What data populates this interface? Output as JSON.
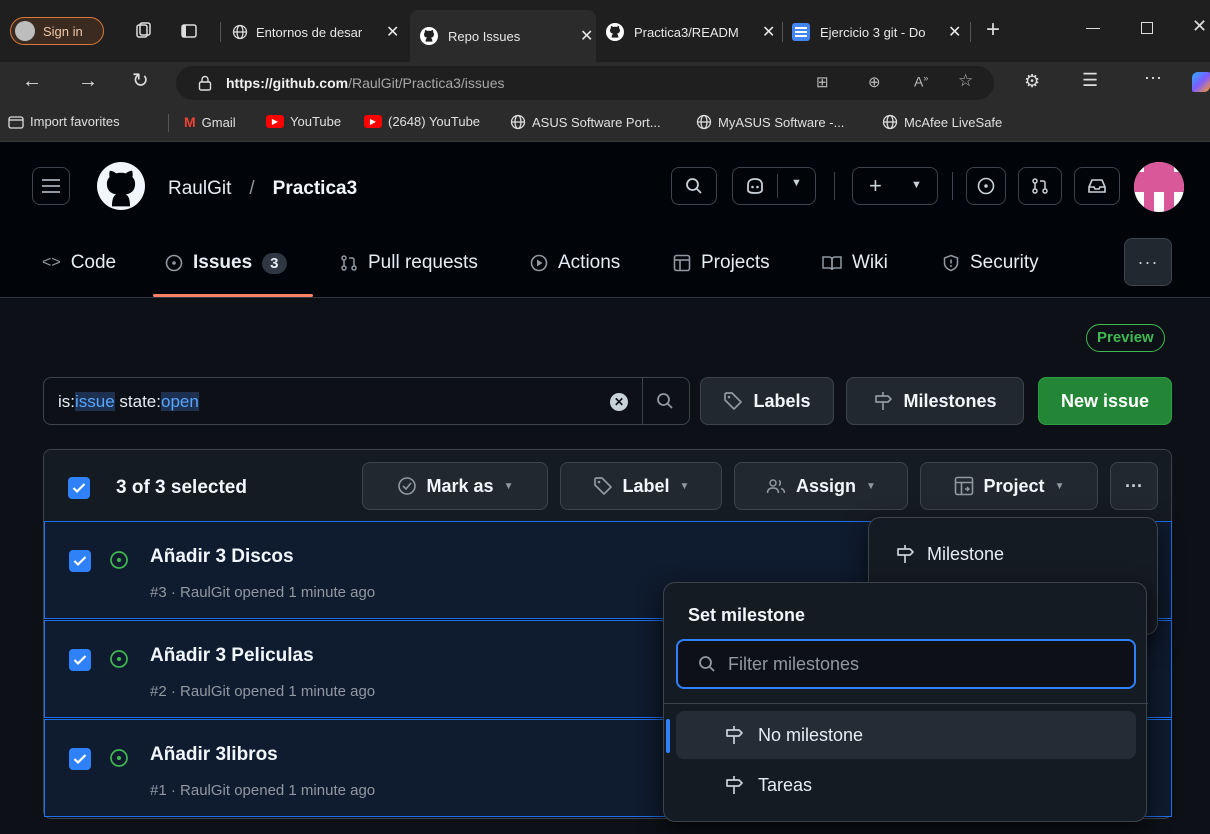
{
  "browser": {
    "profile_label": "Sign in",
    "tabs": [
      {
        "label": "Entornos de desar"
      },
      {
        "label": "Repo Issues"
      },
      {
        "label": "Practica3/READM"
      },
      {
        "label": "Ejercicio 3 git - Do"
      }
    ],
    "url_bold": "https://github.com",
    "url_rest": "/RaulGit/Practica3/issues",
    "favorites": [
      {
        "label": "Import favorites"
      },
      {
        "label": "Gmail"
      },
      {
        "label": "YouTube"
      },
      {
        "label": "(2648) YouTube"
      },
      {
        "label": "ASUS Software Port..."
      },
      {
        "label": "MyASUS Software -..."
      },
      {
        "label": "McAfee LiveSafe"
      }
    ]
  },
  "header": {
    "owner": "RaulGit",
    "separator": "/",
    "repo": "Practica3"
  },
  "nav": {
    "code": "Code",
    "issues": "Issues",
    "issues_count": "3",
    "pulls": "Pull requests",
    "actions": "Actions",
    "projects": "Projects",
    "wiki": "Wiki",
    "security": "Security"
  },
  "preview_badge": "Preview",
  "search": {
    "qualifier1": "is:",
    "value1": "issue",
    "qualifier2": " state:",
    "value2": "open"
  },
  "buttons": {
    "labels": "Labels",
    "milestones": "Milestones",
    "new_issue": "New issue"
  },
  "toolbar": {
    "selected": "3 of 3 selected",
    "mark_as": "Mark as",
    "label": "Label",
    "assign": "Assign",
    "project": "Project"
  },
  "issues": [
    {
      "title": "Añadir 3 Discos",
      "meta": "#3 · RaulGit opened 1 minute ago"
    },
    {
      "title": "Añadir 3 Peliculas",
      "meta": "#2 · RaulGit opened 1 minute ago"
    },
    {
      "title": "Añadir 3libros",
      "meta": "#1 · RaulGit opened 1 minute ago"
    }
  ],
  "overflow_menu": {
    "milestone": "Milestone"
  },
  "milestone_panel": {
    "title": "Set milestone",
    "filter_placeholder": "Filter milestones",
    "options": [
      {
        "label": "No milestone"
      },
      {
        "label": "Tareas"
      }
    ]
  },
  "colors": {
    "accent": "#2f81f7",
    "open": "#3fb950",
    "new_issue_bg": "#238636",
    "page_bg": "#0d1117"
  }
}
